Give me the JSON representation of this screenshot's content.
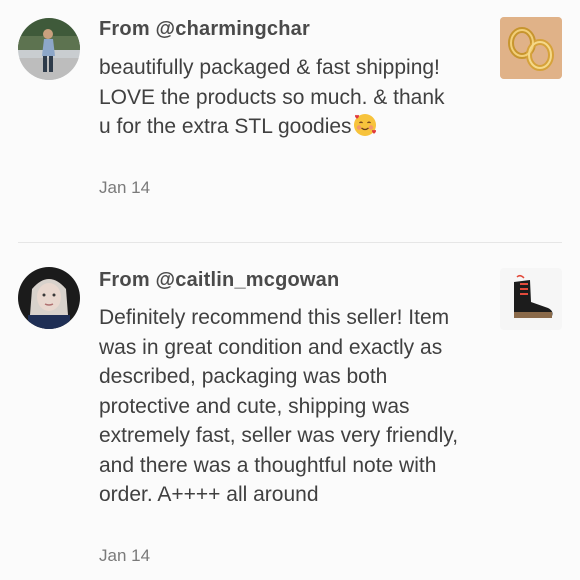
{
  "reviews": [
    {
      "author": "From @charmingchar",
      "text": "beautifully packaged & fast shipping! LOVE the products so much. & thank u for the extra STL goodies",
      "emoji": "🥰",
      "date": "Jan 14",
      "thumbnail_icon": "gold-hoop-earrings-photo",
      "avatar_icon": "user-avatar-photo"
    },
    {
      "author": "From @caitlin_mcgowan",
      "text": "Definitely recommend this seller! Item was in great condition and exactly as described, packaging was both protective and cute, shipping was extremely fast, seller was very friendly, and there was a thoughtful note with order. A++++ all around",
      "date": "Jan 14",
      "thumbnail_icon": "black-boot-photo",
      "avatar_icon": "user-avatar-photo"
    }
  ],
  "colors": {
    "background": "#fbfbfb",
    "text": "#404040",
    "date": "#7a7a7a",
    "divider": "#e6e6e6"
  }
}
